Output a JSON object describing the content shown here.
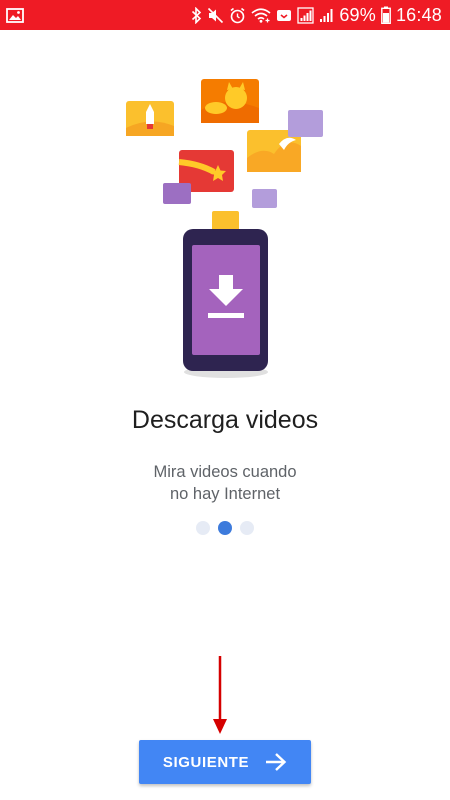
{
  "status_bar": {
    "battery_percent": "69%",
    "time": "16:48",
    "icons": [
      "gallery-notification-icon",
      "bluetooth-icon",
      "mute-icon",
      "alarm-icon",
      "wifi-icon",
      "cast-icon",
      "signal-icon",
      "signal-icon",
      "battery-icon"
    ],
    "background_color": "#ef1b25"
  },
  "onboarding": {
    "title": "Descarga videos",
    "subtitle_line1": "Mira videos cuando",
    "subtitle_line2": "no hay Internet",
    "page_count": 3,
    "current_page": 2,
    "illustration_icon": "download-icon"
  },
  "actions": {
    "next_label": "SIGUIENTE",
    "next_icon": "arrow-right-icon",
    "accent_color": "#4286f4"
  },
  "annotation": {
    "arrow_color": "#d50000"
  }
}
